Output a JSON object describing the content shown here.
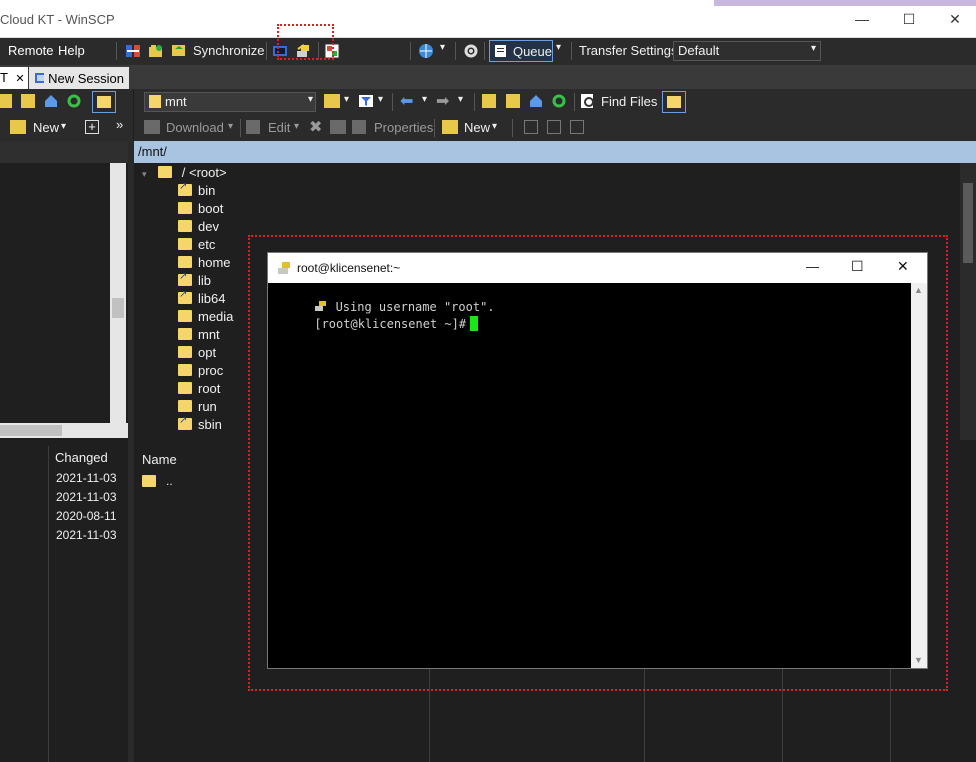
{
  "window": {
    "title": "Cloud KT - WinSCP",
    "minimize": "—",
    "maximize": "☐",
    "close": "✕"
  },
  "menu": {
    "remote": "Remote",
    "help": "Help"
  },
  "toolbar": {
    "synchronize": "Synchronize",
    "queue": "Queue",
    "transfer_settings_label": "Transfer Settings",
    "transfer_settings_value": "Default"
  },
  "tabs": {
    "session_tab_fragment": "T",
    "session_tab_close": "✕",
    "new_session": "New Session"
  },
  "left_panel": {
    "new_label": "New",
    "more": "»",
    "columns": {
      "changed": "Changed"
    },
    "dates": [
      "2021-11-03",
      "2021-11-03",
      "2020-08-11",
      "2021-11-03"
    ]
  },
  "remote_panel": {
    "path_combo": "mnt",
    "find_files": "Find Files",
    "download": "Download",
    "edit": "Edit",
    "properties": "Properties",
    "new_label": "New",
    "path": "/mnt/",
    "tree_root": "/  <root>",
    "tree": [
      "bin",
      "boot",
      "dev",
      "etc",
      "home",
      "lib",
      "lib64",
      "media",
      "mnt",
      "opt",
      "proc",
      "root",
      "run",
      "sbin"
    ],
    "tree_links": [
      "bin",
      "lib",
      "lib64",
      "sbin"
    ],
    "list_header_name": "Name",
    "list_parent": ".."
  },
  "terminal": {
    "title": "root@klicensenet:~",
    "line1": " Using username \"root\".",
    "prompt": "[root@klicensenet ~]#",
    "minimize": "—",
    "maximize": "☐",
    "close": "✕"
  },
  "colors": {
    "highlight_box": "#e02020",
    "path_bar": "#a8c4e0",
    "cursor": "#18e818",
    "folder": "#f5d66b"
  }
}
